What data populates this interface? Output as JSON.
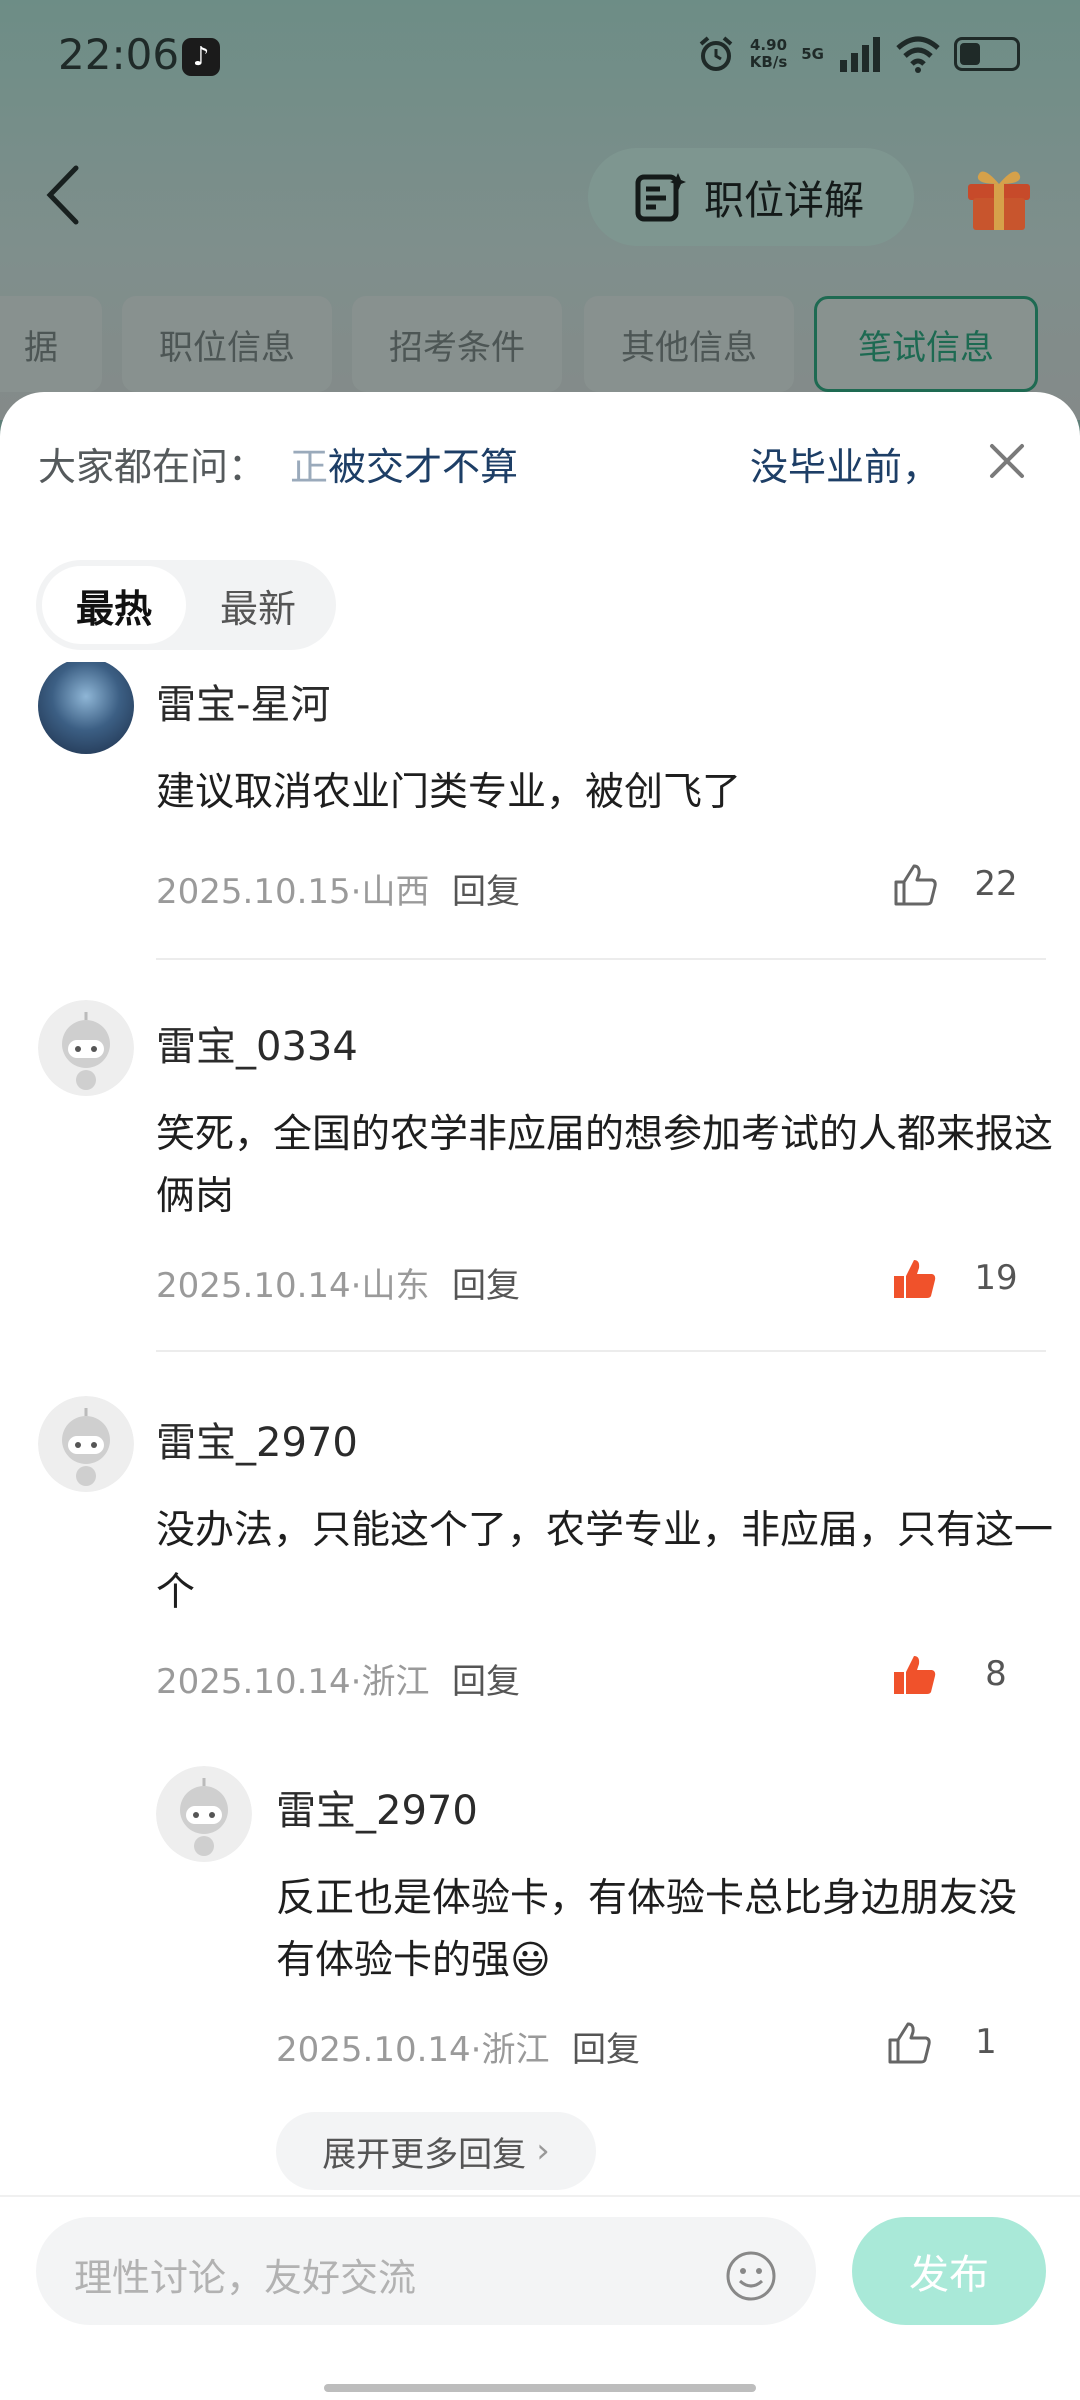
{
  "status": {
    "time": "22:06",
    "speed_value": "4.90",
    "speed_unit": "KB/s",
    "network": "5G"
  },
  "header": {
    "detail_label": "职位详解"
  },
  "bg_tabs": [
    "据",
    "职位信息",
    "招考条件",
    "其他信息",
    "笔试信息"
  ],
  "ask": {
    "label": "大家都在问：",
    "question1_fade": "正",
    "question1": "被交才不算",
    "question2": "没毕业前，"
  },
  "sort": {
    "hot": "最热",
    "new": "最新"
  },
  "comments": [
    {
      "user": "雷宝-星河",
      "text": "建议取消农业门类专业，被创飞了",
      "date": "2025.10.15",
      "region": "山西",
      "likes": "22",
      "liked": false
    },
    {
      "user": "雷宝_0334",
      "text": "笑死，全国的农学非应届的想参加考试的人都来报这俩岗",
      "date": "2025.10.14",
      "region": "山东",
      "likes": "19",
      "liked": true
    },
    {
      "user": "雷宝_2970",
      "text": "没办法，只能这个了，农学专业，非应届，只有这一个",
      "date": "2025.10.14",
      "region": "浙江",
      "likes": "8",
      "liked": true
    },
    {
      "user": "雷宝_2970",
      "text": "反正也是体验卡，有体验卡总比身边朋友没有体验卡的强😃",
      "date": "2025.10.14",
      "region": "浙江",
      "likes": "1",
      "liked": false
    }
  ],
  "reply_label": "回复",
  "meta_separator": "·",
  "expand_label": "展开更多回复",
  "input": {
    "placeholder": "理性讨论，友好交流",
    "publish_label": "发布"
  },
  "colors": {
    "accent": "#a9e9d8",
    "like_active": "#f0522b",
    "link": "#1d3e66"
  }
}
